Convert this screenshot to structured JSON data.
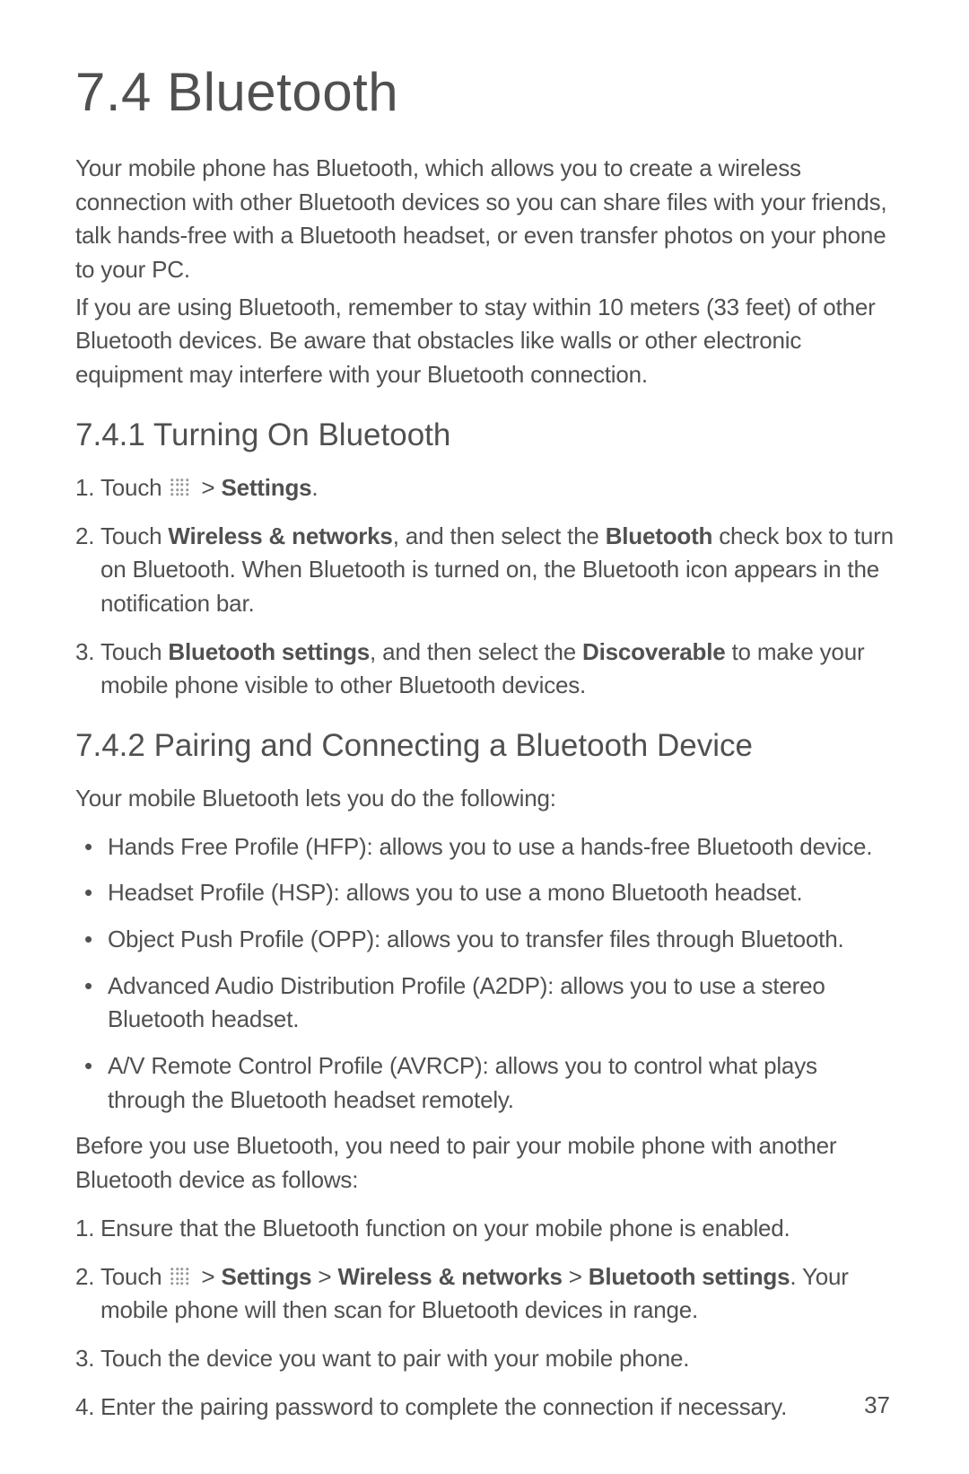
{
  "heading": "7.4  Bluetooth",
  "intro_p1": "Your mobile phone has Bluetooth, which allows you to create a wireless connection with other Bluetooth devices so you can share files with your friends, talk hands-free with a Bluetooth headset, or even transfer photos on your phone to your PC.",
  "intro_p2": "If you are using Bluetooth, remember to stay within 10 meters (33 feet) of other Bluetooth devices. Be aware that obstacles like walls or other electronic equipment may interfere with your Bluetooth connection.",
  "section_741": {
    "title": "7.4.1  Turning On Bluetooth",
    "steps": {
      "s1_a": "Touch ",
      "s1_b": " > ",
      "s1_settings": "Settings",
      "s1_c": ".",
      "s2_a": "Touch ",
      "s2_wn": "Wireless & networks",
      "s2_b": ", and then select the ",
      "s2_bt": "Bluetooth",
      "s2_c": " check box to turn on Bluetooth. When Bluetooth is turned on, the Bluetooth icon appears in the notification bar.",
      "s3_a": "Touch ",
      "s3_bts": "Bluetooth settings",
      "s3_b": ", and then select the ",
      "s3_disc": "Discoverable",
      "s3_c": " to make your mobile phone visible to other Bluetooth devices."
    }
  },
  "section_742": {
    "title": "7.4.2  Pairing and Connecting a Bluetooth Device",
    "intro": "Your mobile Bluetooth lets you do the following:",
    "bullets": {
      "b1": "Hands Free Profile (HFP): allows you to use a hands-free Bluetooth device.",
      "b2": "Headset Profile (HSP): allows you to use a mono Bluetooth headset.",
      "b3": "Object Push Profile (OPP): allows you to transfer files through Bluetooth.",
      "b4": "Advanced Audio Distribution Profile (A2DP): allows you to use a stereo Bluetooth headset.",
      "b5": "A/V Remote Control Profile (AVRCP): allows you to control what plays through the Bluetooth headset remotely."
    },
    "mid": "Before you use Bluetooth, you need to pair your mobile phone with another Bluetooth device as follows:",
    "steps": {
      "s1": "Ensure that the Bluetooth function on your mobile phone is enabled.",
      "s2_a": "Touch ",
      "s2_b": " > ",
      "s2_settings": "Settings",
      "s2_c": " > ",
      "s2_wn": "Wireless & networks",
      "s2_d": " > ",
      "s2_bts": "Bluetooth settings",
      "s2_e": ". Your mobile phone will then scan for Bluetooth devices in range.",
      "s3": "Touch the device you want to pair with your mobile phone.",
      "s4": "Enter the pairing password to complete the connection if necessary."
    }
  },
  "page_number": "37"
}
